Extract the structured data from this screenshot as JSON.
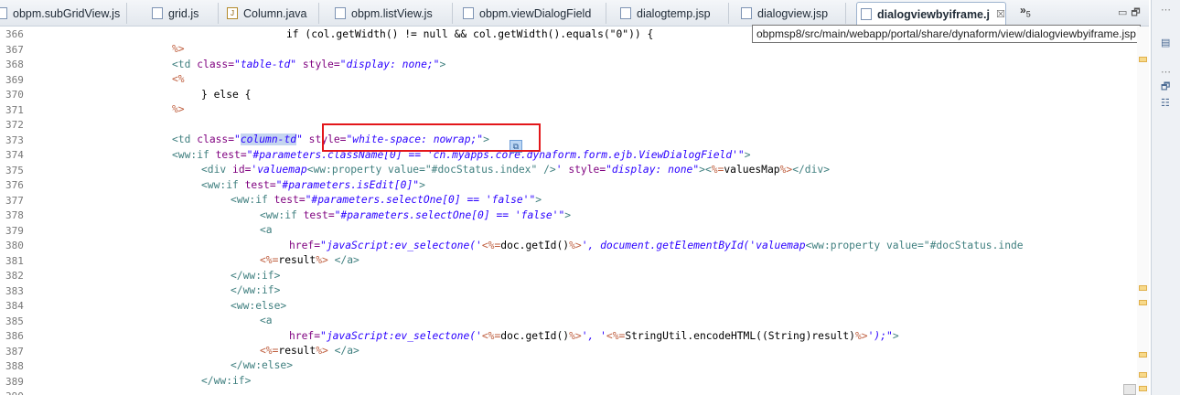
{
  "tabs": [
    {
      "label": "obpm.subGridView.js",
      "icon": "js-file-icon",
      "active": false
    },
    {
      "label": "grid.js",
      "icon": "js-file-icon",
      "active": false
    },
    {
      "label": "Column.java",
      "icon": "java-file-icon",
      "active": false
    },
    {
      "label": "obpm.listView.js",
      "icon": "js-file-icon",
      "active": false
    },
    {
      "label": "obpm.viewDialogField",
      "icon": "js-file-icon",
      "active": false
    },
    {
      "label": "dialogtemp.jsp",
      "icon": "jsp-file-icon",
      "active": false
    },
    {
      "label": "dialogview.jsp",
      "icon": "jsp-file-icon",
      "active": false
    },
    {
      "label": "dialogviewbyiframe.j",
      "icon": "jsp-file-icon",
      "active": true,
      "close": "☒"
    }
  ],
  "overflow": {
    "chevron": "»",
    "count": "5"
  },
  "window_buttons": {
    "minimize": "▭",
    "maximize": "🗗"
  },
  "tooltip": "obpmsp8/src/main/webapp/portal/share/dynaform/view/dialogviewbyiframe.jsp",
  "line_numbers": [
    "366",
    "367",
    "368",
    "369",
    "370",
    "371",
    "372",
    "373",
    "374",
    "375",
    "376",
    "377",
    "378",
    "379",
    "380",
    "381",
    "382",
    "383",
    "384",
    "385",
    "386",
    "387",
    "388",
    "389",
    "390"
  ],
  "code": {
    "l366": "if (col.getWidth() != null && col.getWidth().equals(\"0\")) {",
    "l367": "%>",
    "l368_tag": "<td ",
    "l368_a1": "class=",
    "l368_v1": "\"table-td\"",
    "l368_a2": " style=",
    "l368_v2": "\"display: none;\"",
    "l368_end": ">",
    "l369": "<%",
    "l370": "} else {",
    "l371": "%>",
    "l373_tag": "<td ",
    "l373_a1": "class=",
    "l373_q1": "\"",
    "l373_v1": "column-td",
    "l373_q2": "\"",
    "l373_a2": " style=",
    "l373_v2": "\"white-space: nowrap;\"",
    "l373_end": ">",
    "l374_tag": "<ww:if ",
    "l374_a1": "test=",
    "l374_v1": "\"#parameters.className[0] == 'cn.myapps.core.dynaform.form.ejb.ViewDialogField'\"",
    "l374_end": ">",
    "l375_tag": "<div ",
    "l375_a1": "id=",
    "l375_v1": "'valuemap",
    "l375_inner": "<ww:property value=\"#docStatus.index\" />",
    "l375_v1b": "'",
    "l375_a2": " style=",
    "l375_v2": "\"display: none\"",
    "l375_mid": "><",
    "l375_jsp": "%=",
    "l375_txt": "valuesMap",
    "l375_jspend": "%>",
    "l375_close": "</div>",
    "l376_tag": "<ww:if ",
    "l376_a1": "test=",
    "l376_v1": "\"#parameters.isEdit[0]\"",
    "l376_end": ">",
    "l377_tag": "<ww:if ",
    "l377_a1": "test=",
    "l377_v1": "\"#parameters.selectOne[0] == 'false'\"",
    "l377_end": ">",
    "l378_tag": "<ww:if ",
    "l378_a1": "test=",
    "l378_v1": "\"#parameters.selectOne[0] == 'false'\"",
    "l378_end": ">",
    "l379": "<a",
    "l380_a1": "href=",
    "l380_v1": "\"javaScript:ev_selectone('",
    "l380_jsp": "<%=",
    "l380_txt": "doc.getId()",
    "l380_jspend": "%>",
    "l380_v2": "', document.getElementById('valuemap",
    "l380_inner": "<ww:property value=\"#docStatus.inde",
    "l381_jsp": "<%=",
    "l381_txt": "result",
    "l381_jspend": "%>",
    "l381_close": " </a>",
    "l382": "</ww:if>",
    "l383": "</ww:if>",
    "l384": "<ww:else>",
    "l385": "<a",
    "l386_a1": "href=",
    "l386_v1": "\"javaScript:ev_selectone('",
    "l386_jsp": "<%=",
    "l386_txt": "doc.getId()",
    "l386_jspend": "%>",
    "l386_v2": "', '",
    "l386_jsp2": "<%=",
    "l386_txt2": "StringUtil.encodeHTML((String)result)",
    "l386_jspend2": "%>",
    "l386_v3": "');\"",
    "l386_end": ">",
    "l387_jsp": "<%=",
    "l387_txt": "result",
    "l387_jspend": "%>",
    "l387_close": " </a>",
    "l388": "</ww:else>",
    "l389": "</ww:if>"
  },
  "highlight_color": "#e3171a"
}
